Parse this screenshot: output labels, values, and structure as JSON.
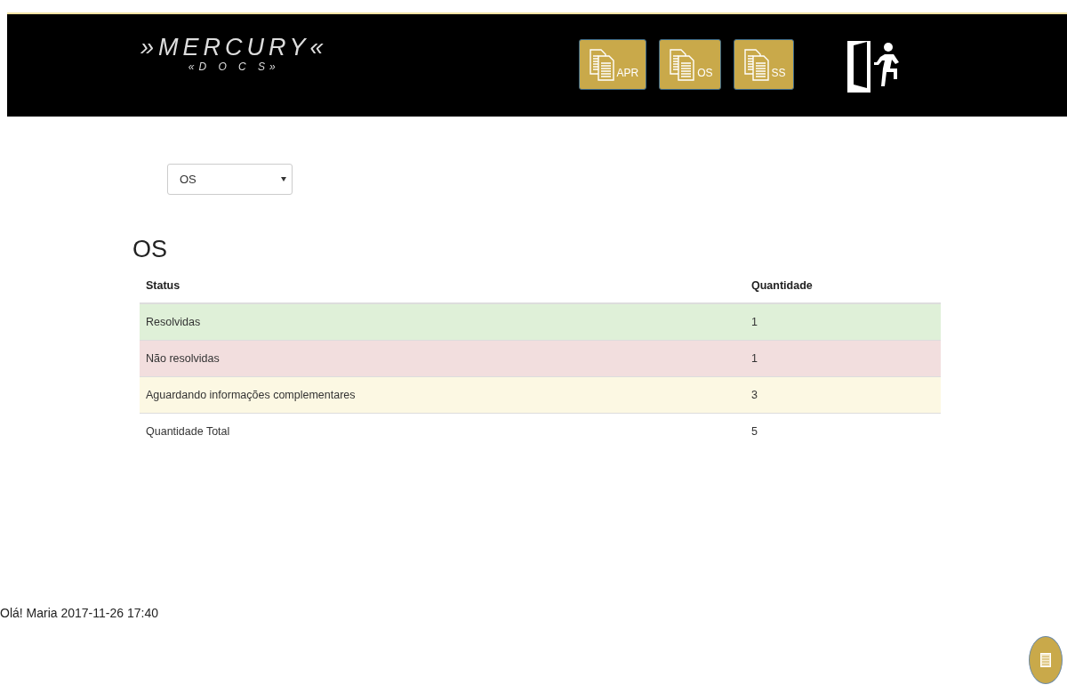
{
  "header": {
    "logo": {
      "title": "»MERCURY«",
      "subtitle": "«D O C S»"
    },
    "buttons": [
      {
        "label": "APR"
      },
      {
        "label": "OS"
      },
      {
        "label": "SS"
      }
    ]
  },
  "filter": {
    "value": "OS"
  },
  "section_title": "OS",
  "table": {
    "columns": [
      "Status",
      "Quantidade"
    ],
    "rows": [
      {
        "kind": "success",
        "status": "Resolvidas",
        "quantity": "1"
      },
      {
        "kind": "danger",
        "status": "Não resolvidas",
        "quantity": "1"
      },
      {
        "kind": "warning",
        "status": "Aguardando informações complementares",
        "quantity": "3"
      },
      {
        "kind": "plain",
        "status": "Quantidade Total",
        "quantity": "5"
      }
    ]
  },
  "footer": {
    "greeting": "Olá! Maria 2017-11-26 17:40"
  }
}
